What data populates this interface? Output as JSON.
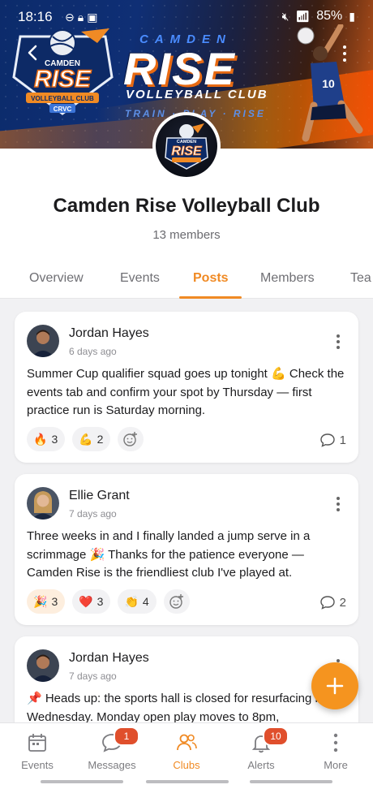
{
  "status_bar": {
    "time": "18:16",
    "battery": "85%"
  },
  "banner": {
    "title_top": "CAMDEN",
    "title_main": "RISE",
    "subtitle": "VOLLEYBALL CLUB",
    "tagline": "TRAIN · PLAY · RISE",
    "badge_top": "CAMDEN",
    "badge_main": "RISE",
    "badge_sub": "VOLLEYBALL CLUB",
    "badge_code": "CRVC",
    "player_number": "10"
  },
  "club": {
    "name": "Camden Rise Volleyball Club",
    "members": "13 members"
  },
  "tabs": [
    {
      "label": "Overview"
    },
    {
      "label": "Events"
    },
    {
      "label": "Posts"
    },
    {
      "label": "Members"
    },
    {
      "label": "Tea"
    }
  ],
  "posts": [
    {
      "author": "Jordan Hayes",
      "time": "6 days ago",
      "body": "Summer Cup qualifier squad goes up tonight 💪 Check the events tab and confirm your spot by Thursday — first practice run is Saturday morning.",
      "reactions": [
        {
          "emoji": "🔥",
          "count": "3"
        },
        {
          "emoji": "💪",
          "count": "2"
        }
      ],
      "comments": "1"
    },
    {
      "author": "Ellie Grant",
      "time": "7 days ago",
      "body": "Three weeks in and I finally landed a jump serve in a scrimmage 🎉 Thanks for the patience everyone — Camden Rise is the friendliest club I've played at.",
      "reactions": [
        {
          "emoji": "🎉",
          "count": "3"
        },
        {
          "emoji": "❤️",
          "count": "3"
        },
        {
          "emoji": "👏",
          "count": "4"
        }
      ],
      "comments": "2"
    },
    {
      "author": "Jordan Hayes",
      "time": "7 days ago",
      "body": "📌 Heads up: the sports hall is closed for resurfacing next Wednesday. Monday open play moves to 8pm,"
    }
  ],
  "nav": [
    {
      "label": "Events",
      "icon": "calendar-icon"
    },
    {
      "label": "Messages",
      "icon": "chat-icon",
      "badge": "1"
    },
    {
      "label": "Clubs",
      "icon": "people-icon"
    },
    {
      "label": "Alerts",
      "icon": "bell-icon",
      "badge": "10"
    },
    {
      "label": "More",
      "icon": "more-vertical-icon"
    }
  ],
  "colors": {
    "accent": "#f08a24",
    "badge": "#e04f2c",
    "fab": "#f5941f"
  }
}
